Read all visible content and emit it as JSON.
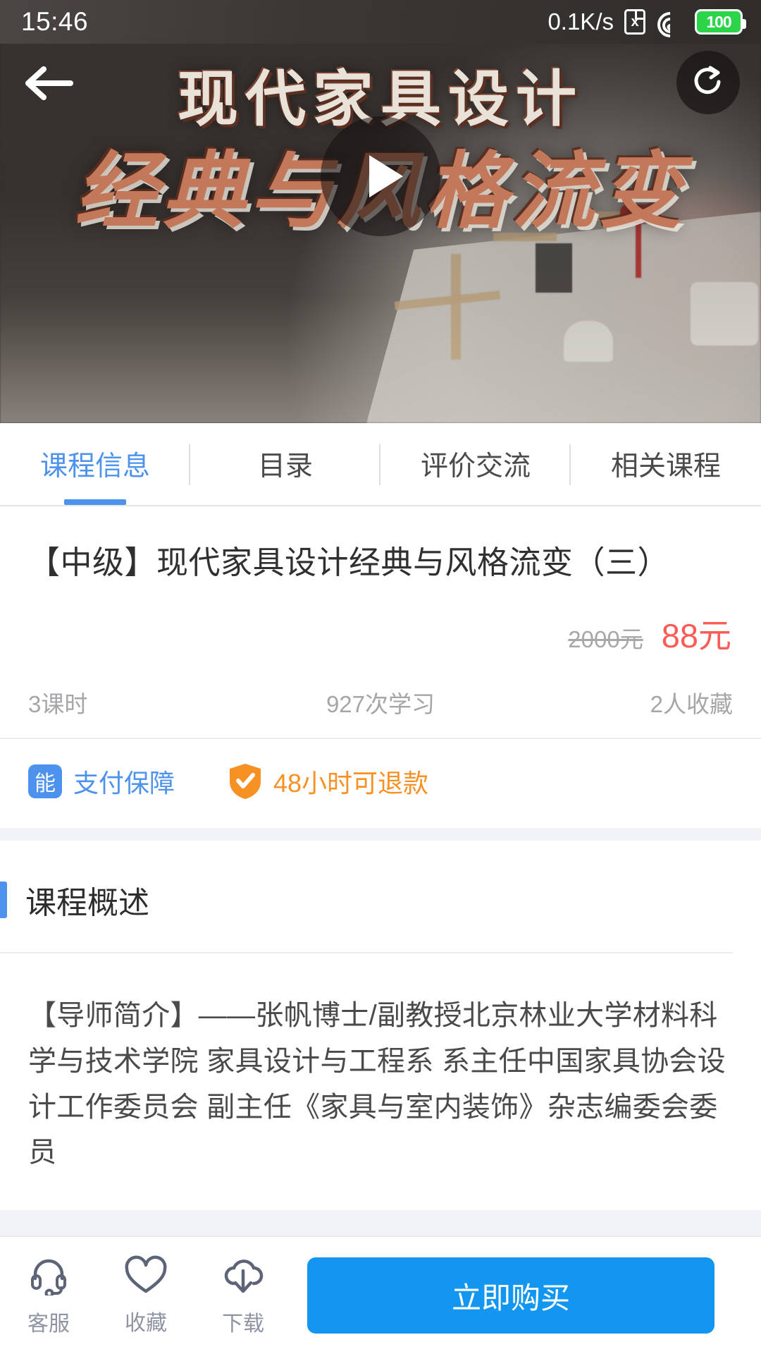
{
  "status_bar": {
    "time": "15:46",
    "network_speed": "0.1K/s",
    "sim_icon": "sim-card-disabled-icon",
    "wifi_icon": "wifi-icon",
    "battery_level": "100"
  },
  "banner": {
    "back_icon": "back-arrow-icon",
    "share_icon": "share-refresh-icon",
    "play_icon": "play-icon",
    "title_line1": "现代家具设计",
    "title_line2": "经典与风格流变"
  },
  "tabs": [
    {
      "label": "课程信息",
      "active": true
    },
    {
      "label": "目录",
      "active": false
    },
    {
      "label": "评价交流",
      "active": false
    },
    {
      "label": "相关课程",
      "active": false
    }
  ],
  "course": {
    "title": "【中级】现代家具设计经典与风格流变（三）",
    "price_original": "2000元",
    "price_current": "88元",
    "stat_lessons": "3课时",
    "stat_views": "927次学习",
    "stat_favorites": "2人收藏",
    "badge_pay_icon_text": "能",
    "badge_pay_label": "支付保障",
    "badge_refund_label": "48小时可退款"
  },
  "overview": {
    "section_title": "课程概述",
    "body": "【导师简介】——张帆博士/副教授北京林业大学材料科学与技术学院 家具设计与工程系 系主任中国家具协会设计工作委员会 副主任《家具与室内装饰》杂志编委会委员",
    "expand_icon": "chevron-down-icon"
  },
  "bottom_bar": {
    "items": [
      {
        "label": "客服",
        "icon": "headset-icon"
      },
      {
        "label": "收藏",
        "icon": "heart-icon"
      },
      {
        "label": "下载",
        "icon": "cloud-download-icon"
      }
    ],
    "buy_label": "立即购买"
  },
  "colors": {
    "accent_blue": "#4d93ee",
    "buy_blue": "#1296f0",
    "price_red": "#fc5c55",
    "refund_orange": "#f79124",
    "battery_green": "#2cd44a"
  }
}
